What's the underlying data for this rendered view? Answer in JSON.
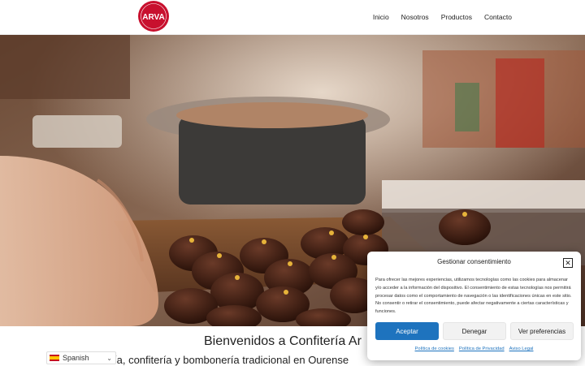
{
  "header": {
    "logo_text": "ARVA",
    "logo_sub": "PASTELERÍA · CONFITERÍA",
    "brand_color": "#c8102e",
    "nav": [
      {
        "label": "Inicio"
      },
      {
        "label": "Nosotros"
      },
      {
        "label": "Productos"
      },
      {
        "label": "Contacto"
      }
    ]
  },
  "welcome": {
    "title": "Bienvenidos a Confitería Ar",
    "subtitle": "ía, confitería y bombonería tradicional en Ourense"
  },
  "language": {
    "label": "Spanish",
    "flag_icon": "spain-flag-icon"
  },
  "consent": {
    "title": "Gestionar consentimiento",
    "body": "Para ofrecer las mejores experiencias, utilizamos tecnologías como las cookies para almacenar y/o acceder a la información del dispositivo. El consentimiento de estas tecnologías nos permitirá procesar datos como el comportamiento de navegación o las identificaciones únicas en este sitio. No consentir o retirar el consentimiento, puede afectar negativamente a ciertas características y funciones.",
    "accept_label": "Aceptar",
    "deny_label": "Denegar",
    "prefs_label": "Ver preferencias",
    "links": [
      "Política de cookies",
      "Política de Privacidad",
      "Aviso Legal"
    ],
    "accent_color": "#1e73be"
  }
}
